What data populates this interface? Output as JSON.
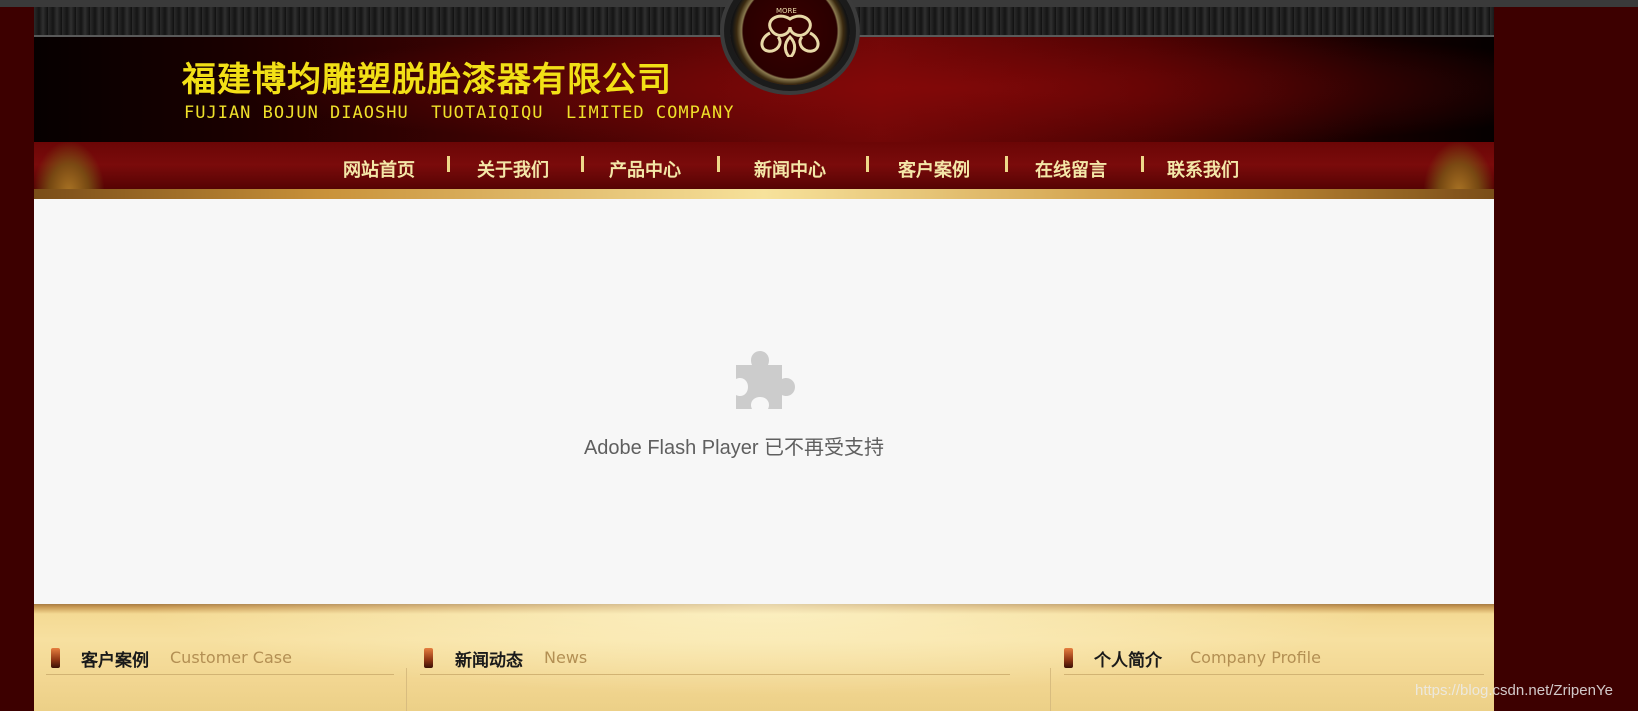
{
  "header": {
    "company_name_cn": "福建博均雕塑脱胎漆器有限公司",
    "company_name_en": "FUJIAN BOJUN DIAOSHU  TUOTAIQIQU  LIMITED COMPANY",
    "medallion_text": "MORE"
  },
  "nav": {
    "items": [
      {
        "label": "网站首页"
      },
      {
        "label": "关于我们"
      },
      {
        "label": "产品中心"
      },
      {
        "label": "新闻中心"
      },
      {
        "label": "客户案例"
      },
      {
        "label": "在线留言"
      },
      {
        "label": "联系我们"
      }
    ]
  },
  "banner": {
    "plugin_message": "Adobe Flash Player 已不再受支持",
    "icon": "puzzle-piece-icon"
  },
  "panels": [
    {
      "title": "客户案例",
      "subtitle": "Customer Case"
    },
    {
      "title": "新闻动态",
      "subtitle": "News"
    },
    {
      "title": "个人简介",
      "subtitle": "Company Profile"
    }
  ],
  "watermark": "https://blog.csdn.net/ZripenYe",
  "colors": {
    "page_background": "#3d0000",
    "brand_yellow": "#f2e016",
    "nav_text": "#f4e7a8",
    "panel_bg": "#f7e0a0",
    "panel_sub": "#b38f53",
    "plugin_text": "#5f5f5f",
    "plugin_icon": "#cccccc"
  }
}
